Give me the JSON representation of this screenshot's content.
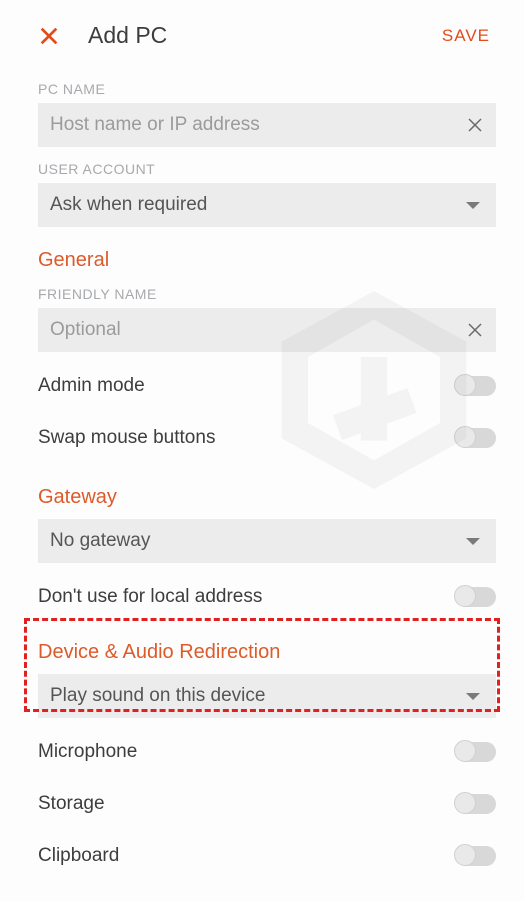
{
  "header": {
    "title": "Add PC",
    "save": "SAVE"
  },
  "pcName": {
    "label": "PC NAME",
    "placeholder": "Host name or IP address"
  },
  "userAccount": {
    "label": "USER ACCOUNT",
    "value": "Ask when required"
  },
  "general": {
    "header": "General",
    "friendlyLabel": "FRIENDLY NAME",
    "friendlyPlaceholder": "Optional",
    "adminMode": "Admin mode",
    "swapMouse": "Swap mouse buttons"
  },
  "gateway": {
    "header": "Gateway",
    "value": "No gateway",
    "noLocal": "Don't use for local address"
  },
  "deviceAudio": {
    "header": "Device & Audio Redirection",
    "soundValue": "Play sound on this device",
    "microphone": "Microphone",
    "storage": "Storage",
    "clipboard": "Clipboard"
  }
}
